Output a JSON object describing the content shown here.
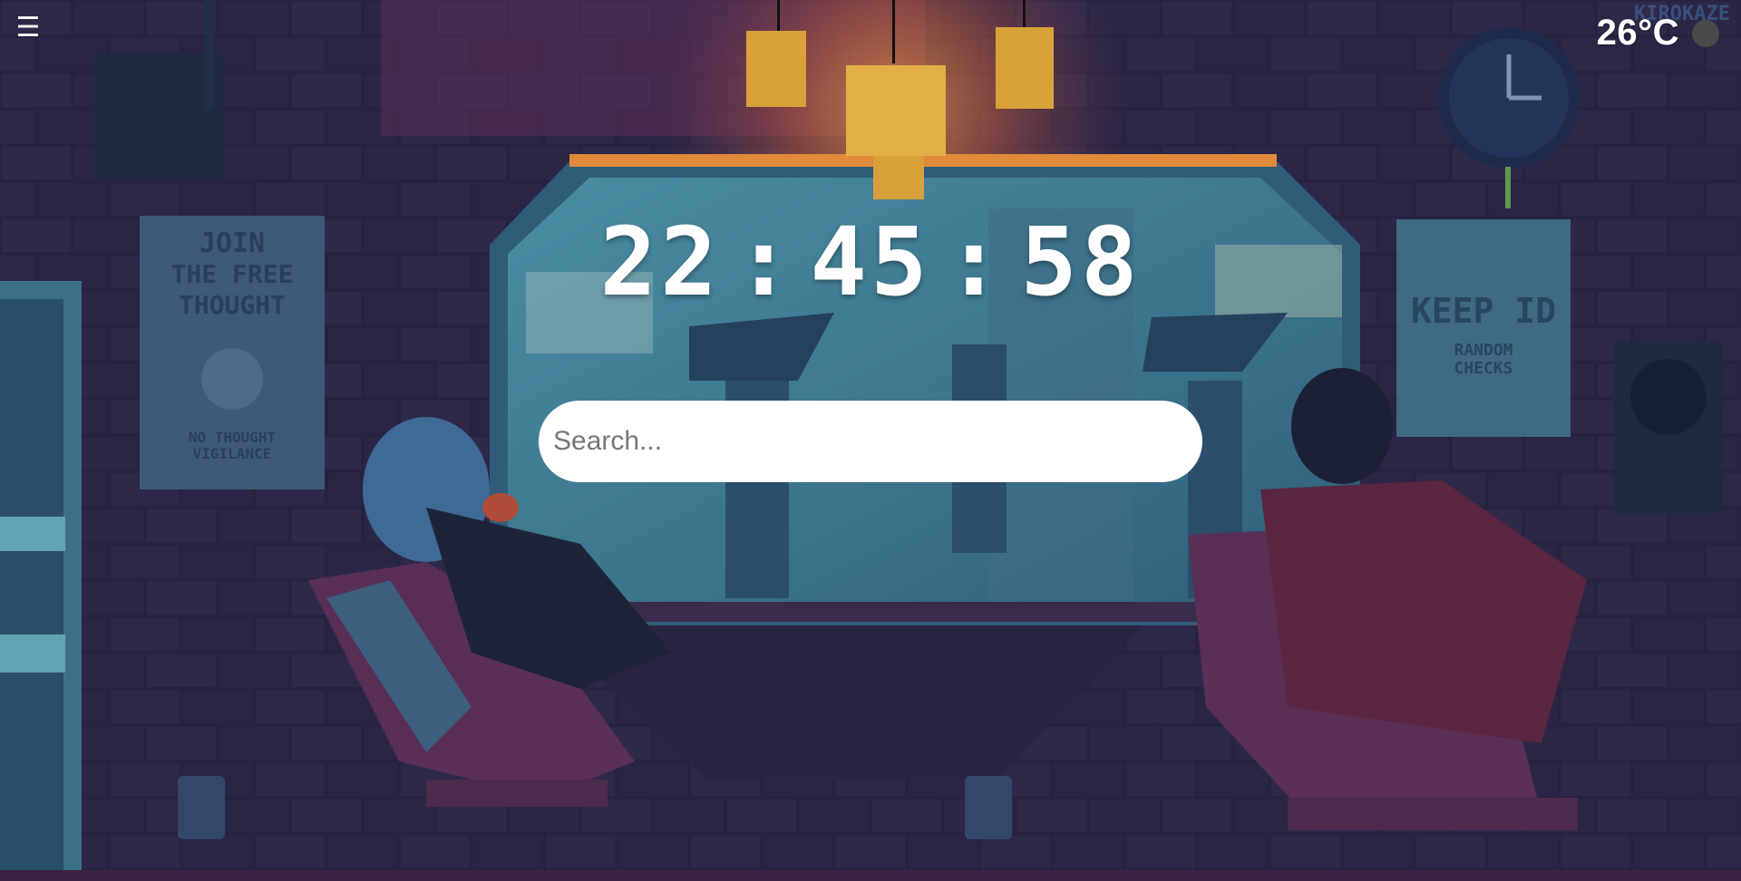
{
  "menu": {
    "icon": "hamburger-menu-icon",
    "glyph": "☰"
  },
  "weather": {
    "temperature": "26°C",
    "toggle_color": "#4a4a4a"
  },
  "clock": {
    "hours": "22",
    "minutes": "45",
    "seconds": "58",
    "separator": ":"
  },
  "search": {
    "placeholder": "Search...",
    "value": ""
  },
  "scene": {
    "poster_left": {
      "line1": "JOIN",
      "line2": "THE FREE",
      "line3": "THOUGHT",
      "footer1": "NO THOUGHT",
      "footer2": "VIGILANCE"
    },
    "poster_right": {
      "line1": "KEEP ID",
      "line2": "RANDOM",
      "line3": "CHECKS"
    },
    "signature": "KIROKAZE"
  },
  "colors": {
    "wall": "#2a2548",
    "brick_light": "#3a2f5e",
    "window_glass": "#3c7f97",
    "lamp_glow": "#e07a3c"
  }
}
